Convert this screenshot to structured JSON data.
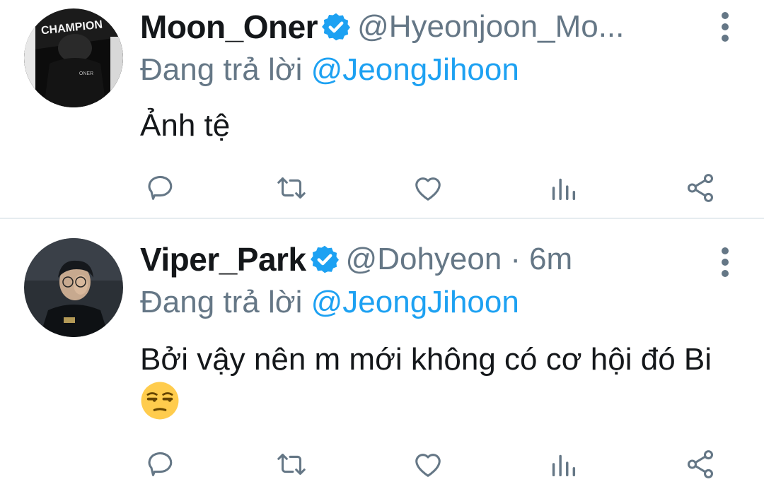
{
  "colors": {
    "accent": "#1da1f2",
    "secondary_text": "#657786",
    "primary_text": "#14171a",
    "divider": "#e6ecf0"
  },
  "tweets": [
    {
      "display_name": "Moon_Oner",
      "handle": "@Hyeonjoon_Mo...",
      "time": "",
      "replying_prefix": "Đang trả lời",
      "replying_to": "@JeongJihoon",
      "text": "Ảnh tệ",
      "avatar_text": [
        "CHAMPION",
        "ONER"
      ],
      "verified": true,
      "icons": [
        "reply-icon",
        "retweet-icon",
        "like-icon",
        "analytics-icon",
        "share-icon",
        "more-icon"
      ]
    },
    {
      "display_name": "Viper_Park",
      "handle": "@Dohyeon",
      "time": "6m",
      "replying_prefix": "Đang trả lời",
      "replying_to": "@JeongJihoon",
      "text": "Bởi vậy nên m mới không có cơ hội đó Bi",
      "emoji": "unamused-face-emoji",
      "verified": true,
      "icons": [
        "reply-icon",
        "retweet-icon",
        "like-icon",
        "analytics-icon",
        "share-icon",
        "more-icon"
      ]
    }
  ]
}
